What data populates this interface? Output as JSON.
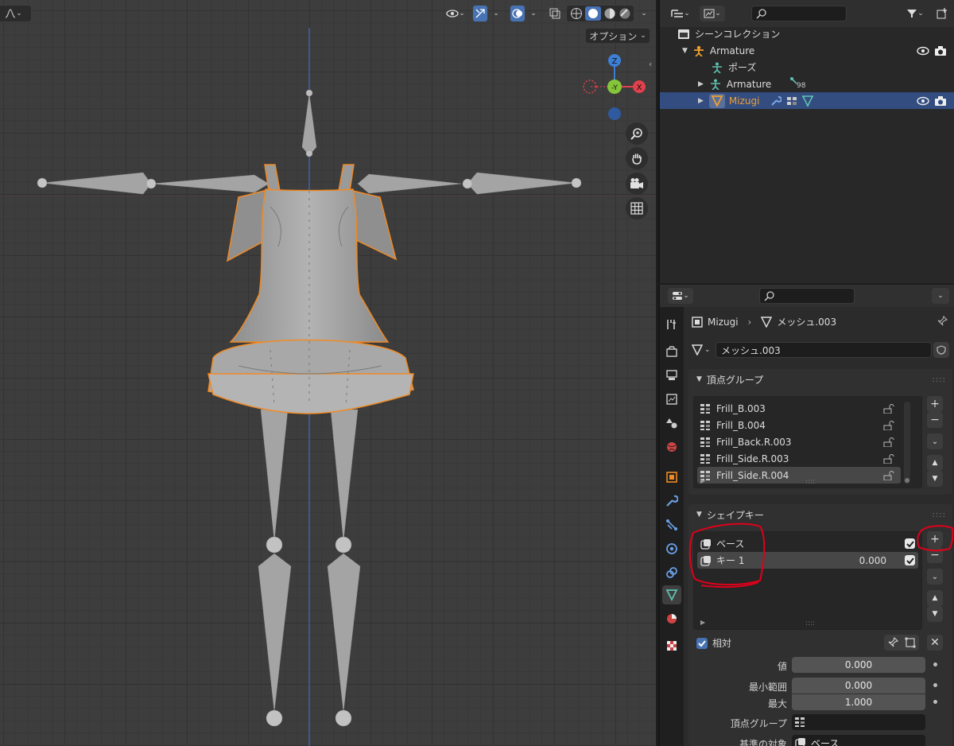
{
  "viewport": {
    "options_label": "オプション",
    "gizmo": {
      "z": "Z",
      "neg_y": "-Y",
      "x": "X"
    }
  },
  "outliner": {
    "scene_collection": "シーンコレクション",
    "items": [
      {
        "label": "Armature"
      },
      {
        "label": "ポーズ"
      },
      {
        "label": "Armature",
        "badge": "98"
      },
      {
        "label": "Mizugi"
      }
    ]
  },
  "properties": {
    "breadcrumb": {
      "object": "Mizugi",
      "mesh": "メッシュ.003"
    },
    "mesh_name": "メッシュ.003",
    "vertex_groups": {
      "title": "頂点グループ",
      "items": [
        "Frill_B.003",
        "Frill_B.004",
        "Frill_Back.R.003",
        "Frill_Side.R.003",
        "Frill_Side.R.004"
      ]
    },
    "shape_keys": {
      "title": "シェイプキー",
      "items": [
        {
          "name": "ベース",
          "value": ""
        },
        {
          "name": "キー 1",
          "value": "0.000"
        }
      ],
      "relative_label": "相対",
      "rows": [
        {
          "label": "値",
          "value": "0.000"
        },
        {
          "label": "最小範囲",
          "value": "0.000"
        },
        {
          "label": "最大",
          "value": "1.000"
        },
        {
          "label": "頂点グループ",
          "value": ""
        },
        {
          "label": "基準の対象",
          "value": "ベース"
        }
      ]
    }
  },
  "colors": {
    "accent_blue": "#4772b3",
    "selection_orange": "#f08a24",
    "annotation_red": "#e0001b",
    "gizmo_x": "#e0414c",
    "gizmo_y": "#85c53a",
    "gizmo_z": "#3d7fd6"
  }
}
